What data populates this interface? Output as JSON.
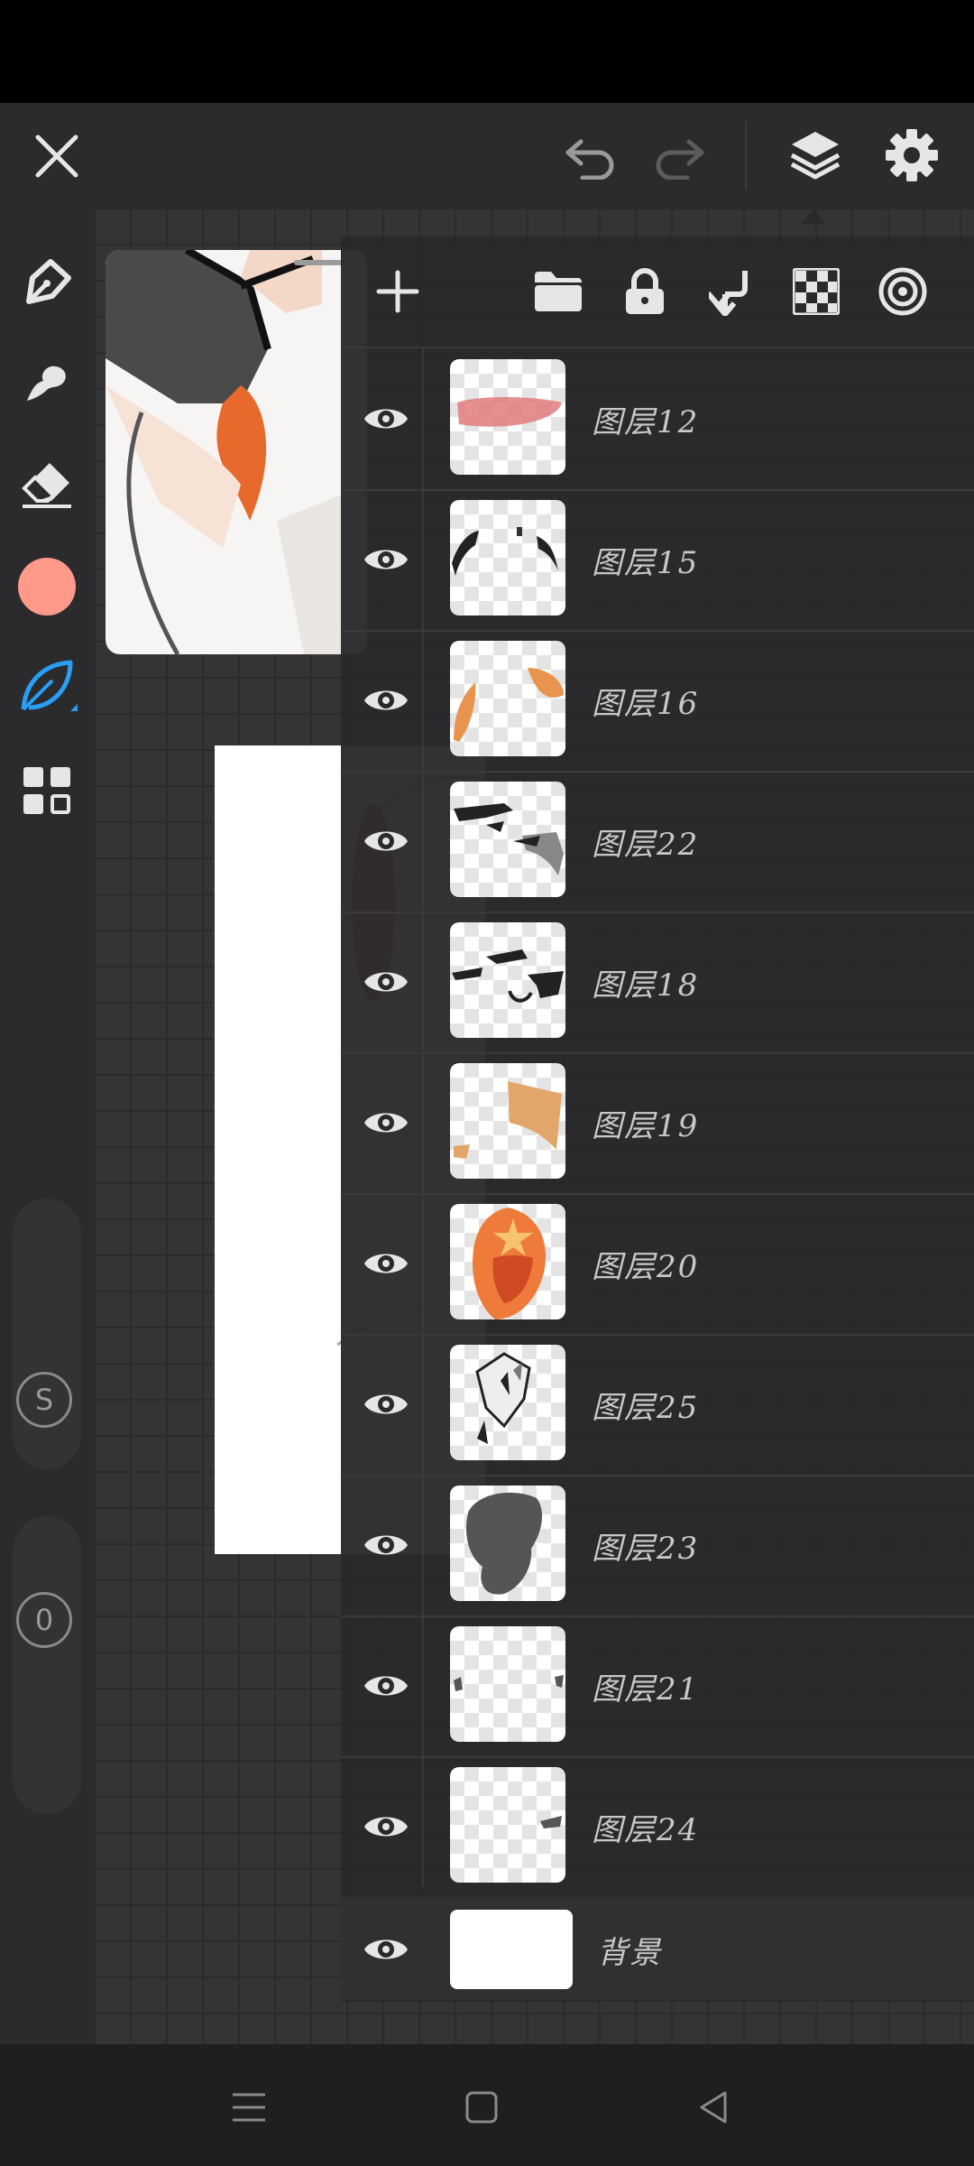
{
  "app": {
    "accent_color": "#2a9df4",
    "brush_color": "#ff9a8b"
  },
  "topbar": {
    "close_icon": "close-icon",
    "undo_icon": "undo-icon",
    "redo_icon": "redo-icon",
    "layers_icon": "layers-icon",
    "settings_icon": "gear-icon"
  },
  "toolbar": {
    "tools": [
      "pen-icon",
      "smudge-icon",
      "eraser-icon",
      "color-swatch",
      "brush-leaf-icon",
      "grid-icon"
    ],
    "size_slider_label": "S",
    "opacity_slider_label": "0"
  },
  "layers_panel": {
    "actions": [
      "add-layer-icon",
      "folder-icon",
      "lock-icon",
      "merge-down-icon",
      "transparency-icon",
      "blend-icon"
    ],
    "layers": [
      {
        "name": "图层12",
        "visible": true
      },
      {
        "name": "图层15",
        "visible": true
      },
      {
        "name": "图层16",
        "visible": true
      },
      {
        "name": "图层22",
        "visible": true
      },
      {
        "name": "图层18",
        "visible": true
      },
      {
        "name": "图层19",
        "visible": true
      },
      {
        "name": "图层20",
        "visible": true
      },
      {
        "name": "图层25",
        "visible": true
      },
      {
        "name": "图层23",
        "visible": true
      },
      {
        "name": "图层21",
        "visible": true
      },
      {
        "name": "图层24",
        "visible": true
      },
      {
        "name": "背景",
        "visible": true
      }
    ]
  },
  "navbar": {
    "menu_icon": "menu-icon",
    "home_icon": "home-icon",
    "back_icon": "back-icon"
  }
}
